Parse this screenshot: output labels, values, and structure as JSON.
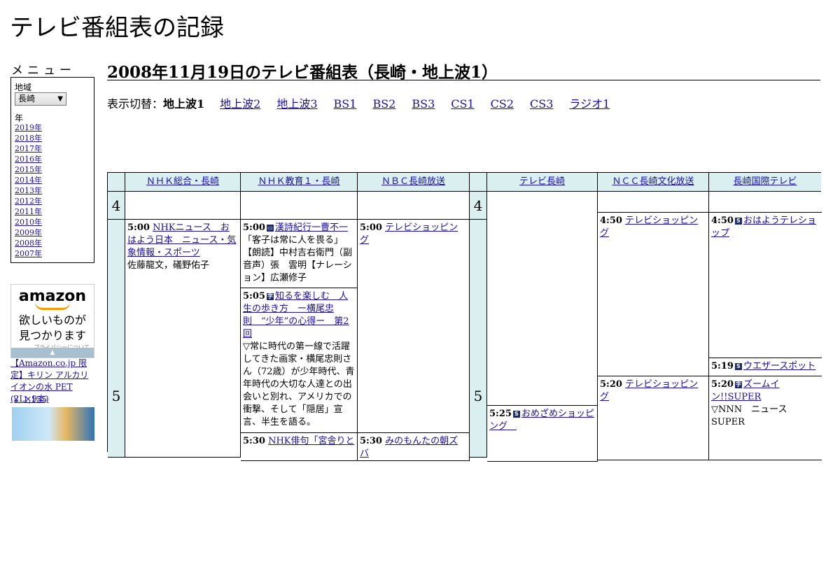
{
  "site_title": "テレビ番組表の記録",
  "menu": {
    "heading": "メニュー",
    "region_label": "地域",
    "region_value": "長崎",
    "year_label": "年",
    "years": [
      "2019年",
      "2018年",
      "2017年",
      "2016年",
      "2015年",
      "2014年",
      "2013年",
      "2012年",
      "2011年",
      "2010年",
      "2009年",
      "2008年",
      "2007年"
    ]
  },
  "ad": {
    "logo": "amazon",
    "tagline_1": "欲しいものが",
    "tagline_2": "見つかります",
    "privacy": "プライバシーについて",
    "product_title": "【Amazon.co.jp 限定】キリン アルカリイオンの水 PET (2L×9本)",
    "product_price": "￥ 1,155"
  },
  "page_title": "2008年11月19日のテレビ番組表（長崎・地上波1）",
  "switch": {
    "label": "表示切替：",
    "current": "地上波1",
    "links": [
      "地上波2",
      "地上波3",
      "BS1",
      "BS2",
      "BS3",
      "CS1",
      "CS2",
      "CS3",
      "ラジオ1"
    ]
  },
  "channels": [
    "ＮＨＫ総合・長崎",
    "ＮＨＫ教育１・長崎",
    "ＮＢＣ長崎放送",
    "テレビ長崎",
    "ＮＣＣ長崎文化放送",
    "長崎国際テレビ"
  ],
  "hours": [
    "4",
    "5"
  ],
  "programs": {
    "nhk1_500": {
      "time": "5:00",
      "title": "NHKニュース　おはよう日本　ニュース・気象情報・スポーツ",
      "desc": "佐藤龍文，礒野佑子"
    },
    "nhke_500": {
      "time": "5:00",
      "title": "漢詩紀行一曹不一",
      "desc": "「客子は常に人を畏る」【朗読】中村吉右衛門（副音声）張　雲明【ナレーション】広瀬修子"
    },
    "nhke_505": {
      "time": "5:05",
      "title": "知るを楽しむ　人生の歩き方　ー横尾忠則　“少年”の心得ー　第2回",
      "desc": "▽常に時代の第一線で活躍してきた画家・横尾忠則さん（72歳）が少年時代、青年時代の大切な人達との出会いと別れ、アメリカでの衝撃、そして「隠居」宣言、半生を語る。"
    },
    "nhke_next": {
      "time": "5:30",
      "title": "NHK俳句「宮舎りと"
    },
    "nbc_500": {
      "time": "5:00",
      "title": "テレビショッピング"
    },
    "nbc_next": {
      "time": "5:30",
      "title": "みのもんたの朝ズバ"
    },
    "ktn_525": {
      "time": "5:25",
      "title": "おめざめショッピング　"
    },
    "ncc_450": {
      "time": "4:50",
      "title": "テレビショッピング"
    },
    "ncc_520": {
      "time": "5:20",
      "title": "テレビショッピング"
    },
    "nib_450": {
      "time": "4:50",
      "title": "おはようテレショップ"
    },
    "nib_519": {
      "time": "5:19",
      "title": "ウエザースポット"
    },
    "nib_520": {
      "time": "5:20",
      "title": "ズームイン!!SUPER",
      "desc": "▽NNN　ニュースSUPER"
    }
  },
  "colors": {
    "header_bg": "#daf0f0",
    "link": "#1a0dab"
  }
}
